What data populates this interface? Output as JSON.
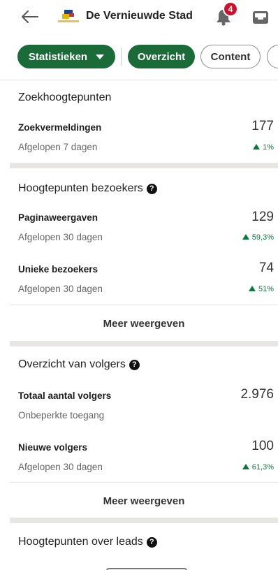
{
  "header": {
    "title": "De Vernieuwde Stad",
    "notification_count": "4"
  },
  "filters": {
    "dropdown_label": "Statistieken",
    "tabs": [
      "Overzicht",
      "Content"
    ]
  },
  "search_highlights": {
    "title": "Zoekhoogtepunten",
    "metric": {
      "label": "Zoekvermeldingen",
      "sub": "Afgelopen 7 dagen",
      "value": "177",
      "delta": "1%"
    }
  },
  "visitor_highlights": {
    "title": "Hoogtepunten bezoekers",
    "metrics": [
      {
        "label": "Paginaweergaven",
        "sub": "Afgelopen 30 dagen",
        "value": "129",
        "delta": "59,3%"
      },
      {
        "label": "Unieke bezoekers",
        "sub": "Afgelopen 30 dagen",
        "value": "74",
        "delta": "51%"
      }
    ],
    "more_label": "Meer weergeven"
  },
  "followers": {
    "title": "Overzicht van volgers",
    "metrics": [
      {
        "label": "Totaal aantal volgers",
        "sub": "Onbeperkte toegang",
        "value": "2.976"
      },
      {
        "label": "Nieuwe volgers",
        "sub": "Afgelopen 30 dagen",
        "value": "100",
        "delta": "61,3%"
      }
    ],
    "more_label": "Meer weergeven"
  },
  "leads": {
    "title": "Hoogtepunten over leads"
  },
  "colors": {
    "brand_green": "#1b6b38",
    "positive": "#0a7a3c",
    "badge_red": "#cb112d"
  },
  "icons": [
    "back-arrow-icon",
    "bell-icon",
    "inbox-icon",
    "help-icon",
    "triangle-up-icon",
    "chevron-down-icon"
  ]
}
